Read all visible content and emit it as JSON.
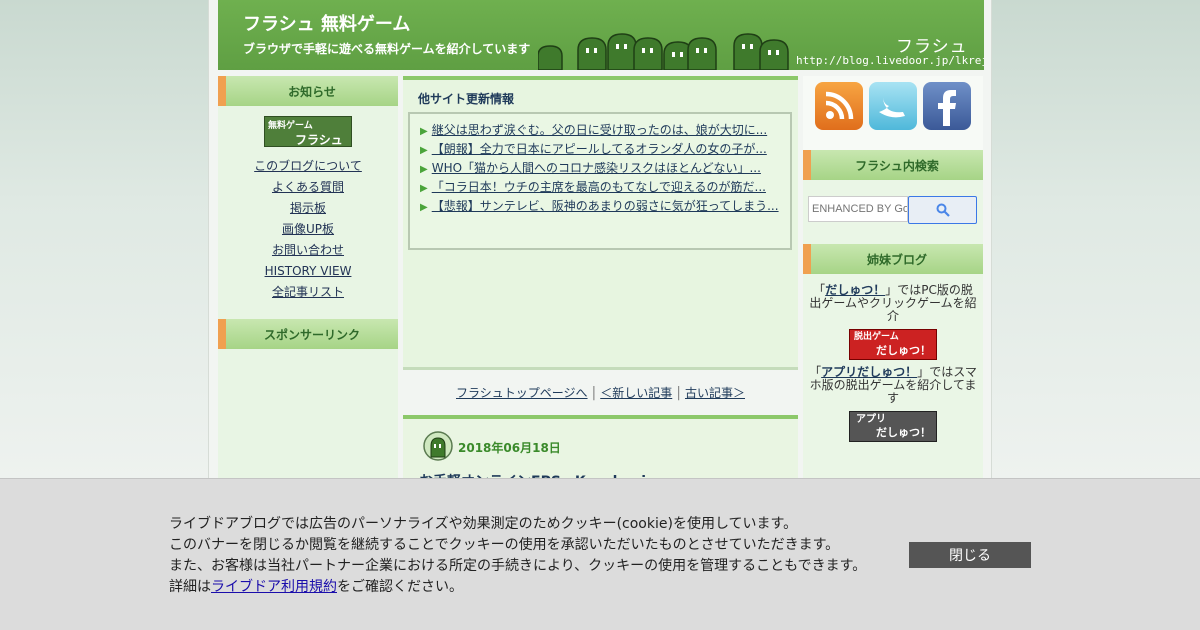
{
  "header": {
    "title": "フラシュ 無料ゲーム",
    "subtitle": "ブラウザで手軽に遊べる無料ゲームを紹介しています",
    "logo_text": "フラシュ",
    "url_text": "http://blog.livedoor.jp/lkrejg/"
  },
  "left": {
    "notice_heading": "お知らせ",
    "banner_text_top": "無料ゲーム",
    "banner_text_bottom": "フラシュ",
    "links": [
      "このブログについて",
      "よくある質問",
      "掲示板",
      "画像UP板",
      "お問い合わせ",
      "HISTORY VIEW",
      "全記事リスト"
    ],
    "sponsor_heading": "スポンサーリンク"
  },
  "main": {
    "updates_title": "他サイト更新情報",
    "updates": [
      "継父は思わず涙ぐむ。父の日に受け取ったのは、娘が大切に...",
      "【朗報】全力で日本にアピールしてるオランダ人の女の子が...",
      "WHO「猫から人間へのコロナ感染リスクはほとんどない」...",
      "「コラ日本！ウチの主席を最高のもてなしで迎えるのが筋だ...",
      "【悲報】サンテレビ、阪神のあまりの弱さに気が狂ってしまう..."
    ],
    "pager": {
      "top": "フラシュトップページへ",
      "newer": "＜新しい記事",
      "older": "古い記事＞"
    },
    "article": {
      "date": "2018年06月18日",
      "title": "お手軽オンラインFPS　Krunker.io"
    }
  },
  "right": {
    "social": [
      "rss-icon",
      "twitter-icon",
      "facebook-icon"
    ],
    "search_heading": "フラシュ内検索",
    "search_placeholder": "ENHANCED BY Google",
    "sister_heading": "姉妹ブログ",
    "sister1_prefix": "「",
    "sister1_link": "だしゅつ！",
    "sister1_suffix": "」ではPC版の脱出ゲームやクリックゲームを紹介",
    "sister1_banner_top": "脱出ゲーム",
    "sister1_banner_bottom": "だしゅつ！",
    "sister2_prefix": "「",
    "sister2_link": "アプリだしゅつ！",
    "sister2_suffix": "」ではスマホ版の脱出ゲームを紹介してます",
    "sister2_banner_top": "アプリ",
    "sister2_banner_bottom": "だしゅつ！"
  },
  "cookie": {
    "line1": "ライブドアブログでは広告のパーソナライズや効果測定のためクッキー(cookie)を使用しています。",
    "line2": "このバナーを閉じるか閲覧を継続することでクッキーの使用を承認いただいたものとさせていただきます。",
    "line3": "また、お客様は当社パートナー企業における所定の手続きにより、クッキーの使用を管理することもできます。",
    "line4_prefix": "詳細は",
    "line4_link": "ライブドア利用規約",
    "line4_suffix": "をご確認ください。",
    "close_label": "閉じる"
  },
  "colors": {
    "header_green": "#5f9f43",
    "accent_orange": "#f0a050",
    "link_navy": "#1f3a5a"
  }
}
